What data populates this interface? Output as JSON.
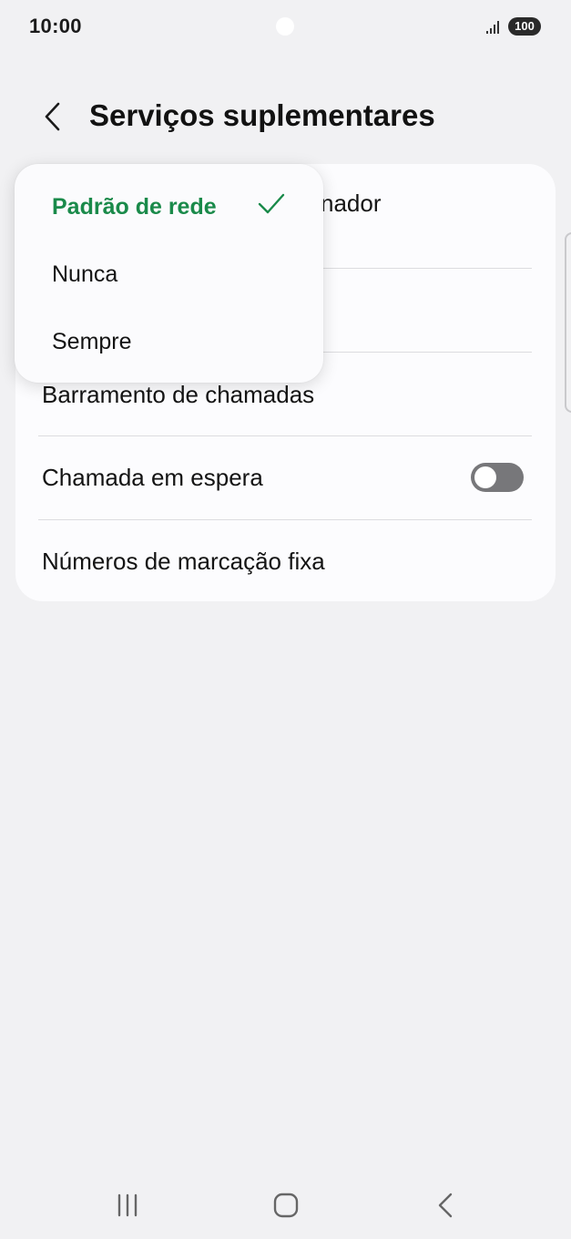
{
  "status_bar": {
    "time": "10:00",
    "battery": "100",
    "icons": [
      "signal-icon",
      "battery-icon"
    ]
  },
  "header": {
    "title": "Serviços suplementares",
    "back_icon": "chevron-left-icon"
  },
  "settings": {
    "row_behind_popup_suffix": "nador",
    "items": [
      {
        "label": "Barramento de chamadas"
      },
      {
        "label": "Chamada em espera",
        "toggle": false
      },
      {
        "label": "Números de marcação fixa"
      }
    ]
  },
  "popup": {
    "options": [
      {
        "label": "Padrão de rede",
        "selected": true
      },
      {
        "label": "Nunca",
        "selected": false
      },
      {
        "label": "Sempre",
        "selected": false
      }
    ],
    "accent_color": "#1a8a4a"
  },
  "nav_bar": {
    "icons": [
      "recent-apps-icon",
      "home-icon",
      "back-icon"
    ]
  }
}
